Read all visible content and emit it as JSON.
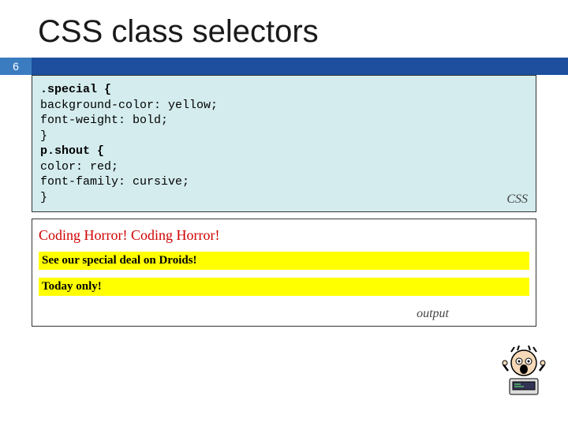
{
  "page_number": "6",
  "title": "CSS class selectors",
  "code_block": {
    "line1": ".special {",
    "line2": "background-color: yellow;",
    "line3": "font-weight: bold;",
    "line4": "}",
    "line5": "p.shout {",
    "line6": "color: red;",
    "line7": "font-family: cursive;",
    "line8": "}",
    "label": "CSS"
  },
  "output_block": {
    "shout_text": "Coding Horror! Coding Horror!",
    "special1": "See our special deal on Droids!",
    "special2": "Today only!",
    "label": "output"
  }
}
